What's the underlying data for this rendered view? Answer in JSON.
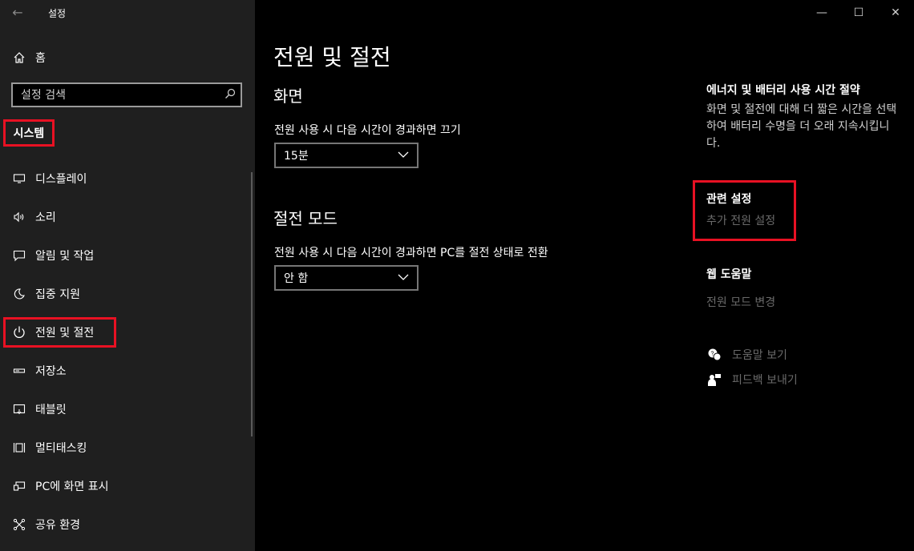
{
  "window": {
    "title": "설정",
    "controls": {
      "minimize": "—",
      "maximize": "☐",
      "close": "✕"
    }
  },
  "sidebar": {
    "home_label": "홈",
    "search_placeholder": "설정 검색",
    "section_label": "시스템",
    "items": [
      {
        "label": "디스플레이",
        "icon": "display-icon"
      },
      {
        "label": "소리",
        "icon": "speaker-icon"
      },
      {
        "label": "알림 및 작업",
        "icon": "notification-icon"
      },
      {
        "label": "집중 지원",
        "icon": "moon-icon"
      },
      {
        "label": "전원 및 절전",
        "icon": "power-icon",
        "selected": true
      },
      {
        "label": "저장소",
        "icon": "storage-icon"
      },
      {
        "label": "태블릿",
        "icon": "tablet-icon"
      },
      {
        "label": "멀티태스킹",
        "icon": "multitasking-icon"
      },
      {
        "label": "PC에 화면 표시",
        "icon": "project-icon"
      },
      {
        "label": "공유 환경",
        "icon": "shared-icon"
      }
    ]
  },
  "main": {
    "page_title": "전원 및 절전",
    "screen": {
      "title": "화면",
      "label": "전원 사용 시 다음 시간이 경과하면 끄기",
      "value": "15분"
    },
    "sleep": {
      "title": "절전 모드",
      "label": "전원 사용 시 다음 시간이 경과하면 PC를 절전 상태로 전환",
      "value": "안 함"
    }
  },
  "right": {
    "battery_title": "에너지 및 배터리 사용 시간 절약",
    "battery_text": "화면 및 절전에 대해 더 짧은 시간을 선택하여 배터리 수명을 더 오래 지속시킵니다.",
    "related_title": "관련 설정",
    "related_link": "추가 전원 설정",
    "web_help_title": "웹 도움말",
    "web_help_link": "전원 모드 변경",
    "get_help": "도움말 보기",
    "feedback": "피드백 보내기"
  }
}
